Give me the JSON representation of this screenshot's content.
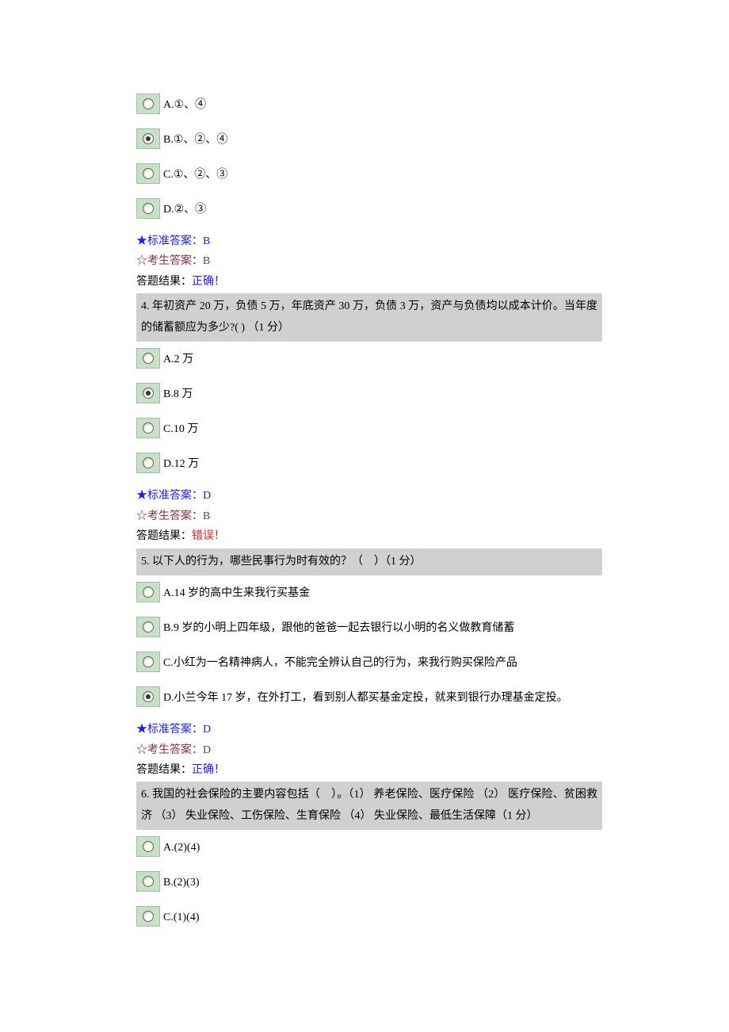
{
  "q3": {
    "options": [
      {
        "label": "A.①、④",
        "selected": false
      },
      {
        "label": "B.①、②、④",
        "selected": true
      },
      {
        "label": "C.①、②、③",
        "selected": false
      },
      {
        "label": "D.②、③",
        "selected": false
      }
    ],
    "stdLabel": "★标准答案：",
    "stdValue": "B",
    "userLabel": "☆考生答案：",
    "userValue": "B",
    "resultLabel": "答题结果：",
    "resultValue": "正确！",
    "resultCorrect": true
  },
  "q4": {
    "question": "4. 年初资产 20 万，负债 5 万，年底资产 30 万，负债 3 万，资产与负债均以成本计价。当年度的储蓄额应为多少?( ) （1 分）",
    "options": [
      {
        "label": "A.2 万",
        "selected": false
      },
      {
        "label": "B.8 万",
        "selected": true
      },
      {
        "label": "C.10 万",
        "selected": false
      },
      {
        "label": "D.12 万",
        "selected": false
      }
    ],
    "stdLabel": "★标准答案：",
    "stdValue": "D",
    "userLabel": "☆考生答案：",
    "userValue": "B",
    "resultLabel": "答题结果：",
    "resultValue": "错误！",
    "resultCorrect": false
  },
  "q5": {
    "question": "5. 以下人的行为，哪些民事行为时有效的？（　）（1 分）",
    "options": [
      {
        "label": "A.14 岁的高中生来我行买基金",
        "selected": false
      },
      {
        "label": "B.9 岁的小明上四年级，跟他的爸爸一起去银行以小明的名义做教育储蓄",
        "selected": false
      },
      {
        "label": "C.小红为一名精神病人，不能完全辨认自己的行为，来我行购买保险产品",
        "selected": false
      },
      {
        "label": "D.小兰今年 17 岁，在外打工，看到别人都买基金定投，就来到银行办理基金定投。",
        "selected": true
      }
    ],
    "stdLabel": "★标准答案：",
    "stdValue": "D",
    "userLabel": "☆考生答案：",
    "userValue": "D",
    "resultLabel": "答题结果：",
    "resultValue": "正确！",
    "resultCorrect": true
  },
  "q6": {
    "question": "6. 我国的社会保险的主要内容包括（　）。（1） 养老保险、医疗保险 （2） 医疗保险、贫困救济 （3） 失业保险、工伤保险、生育保险 （4） 失业保险、最低生活保障（1 分）",
    "options": [
      {
        "label": "A.(2)(4)",
        "selected": false
      },
      {
        "label": "B.(2)(3)",
        "selected": false
      },
      {
        "label": "C.(1)(4)",
        "selected": false
      }
    ]
  }
}
